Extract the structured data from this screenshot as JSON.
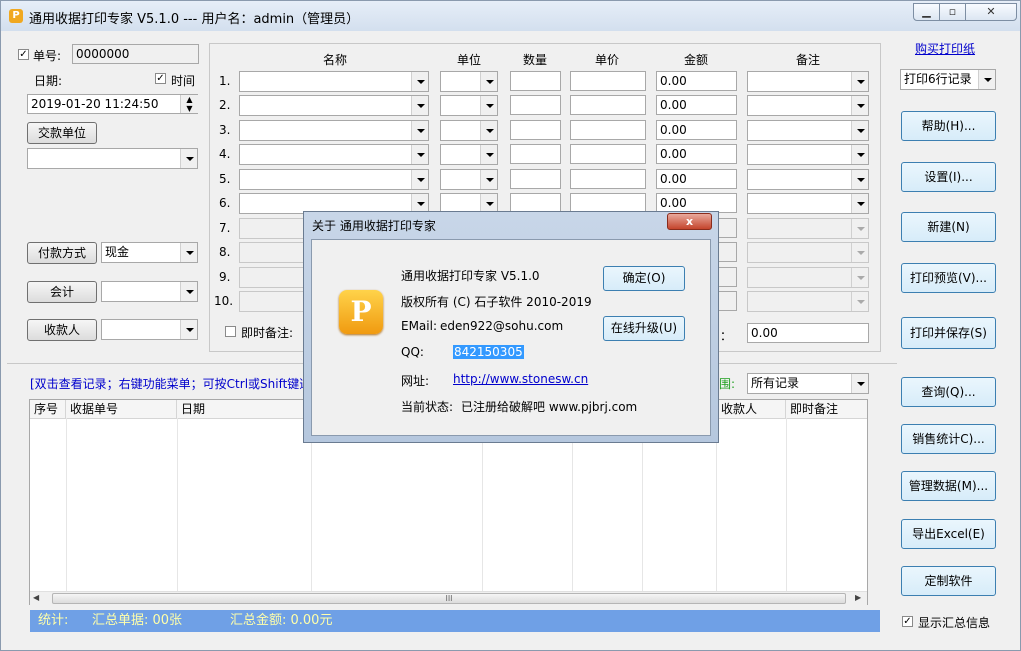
{
  "window": {
    "title": "通用收据打印专家 V5.1.0 --- 用户名：admin（管理员）",
    "icon": "P",
    "caption_buttons": [
      "minimize-icon",
      "maximize-icon",
      "close-icon"
    ]
  },
  "left_panel": {
    "receipt_no_label": "单号:",
    "receipt_no_checked": true,
    "receipt_no_value": "0000000",
    "date_label": "日期:",
    "time_label": "时间",
    "time_checked": true,
    "datetime_value": "2019-01-20 11:24:50",
    "payer_button": "交款单位",
    "payer_value": "",
    "payment_method_button": "付款方式",
    "payment_method_value": "现金",
    "accountant_button": "会计",
    "accountant_value": "",
    "payee_button": "收款人",
    "payee_value": ""
  },
  "items_table": {
    "headers": [
      "名称",
      "单位",
      "数量",
      "单价",
      "金额",
      "备注"
    ],
    "row_numbers": [
      "1.",
      "2.",
      "3.",
      "4.",
      "5.",
      "6.",
      "7.",
      "8.",
      "9.",
      "10."
    ],
    "amount_values": [
      "0.00",
      "0.00",
      "0.00",
      "0.00",
      "0.00",
      "0.00"
    ],
    "instant_note_label": "即时备注:",
    "total_label_partial": "：",
    "total_value": "0.00"
  },
  "right_panel": {
    "buy_paper_link": "购买打印纸",
    "print_rows_option": "打印6行记录",
    "buttons": [
      "帮助(H)...",
      "设置(I)...",
      "新建(N)",
      "打印预览(V)...",
      "打印并保存(S)",
      "查询(Q)...",
      "销售统计C)...",
      "管理数据(M)...",
      "导出Excel(E)",
      "定制软件"
    ],
    "show_summary_label": "显示汇总信息",
    "show_summary_checked": true
  },
  "records": {
    "hint": "[双击查看记录；右键功能菜单；可按Ctrl或Shift键选",
    "range_label": "围:",
    "range_value": "所有记录",
    "columns": [
      "序号",
      "收据单号",
      "日期",
      "收款人",
      "即时备注"
    ],
    "scroll_thumb": "III"
  },
  "statusbar": {
    "stats_label": "统计:",
    "total_receipts": "汇总单据: 00张",
    "total_amount": "汇总金额: 0.00元"
  },
  "about_dialog": {
    "title": "关于 通用收据打印专家",
    "logo_letter": "P",
    "product": "通用收据打印专家 V5.1.0",
    "copyright": "版权所有 (C) 石子软件 2010-2019",
    "email_label": "EMail:",
    "email_value": "eden922@sohu.com",
    "qq_label": "QQ:",
    "qq_value": "842150305",
    "website_label": "网址:",
    "website_value": "http://www.stonesw.cn",
    "status_label": "当前状态:",
    "status_value": "已注册给破解吧 www.pjbrj.com",
    "ok_button": "确定(O)",
    "upgrade_button": "在线升级(U)",
    "close_symbol": "x"
  }
}
